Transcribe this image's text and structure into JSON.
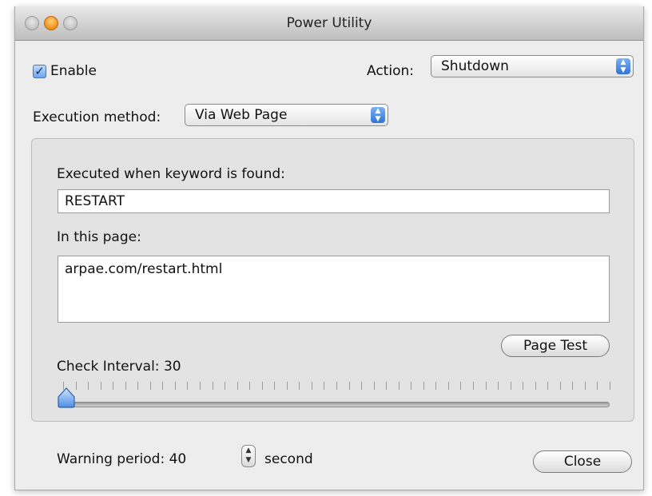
{
  "window": {
    "title": "Power Utility"
  },
  "enable": {
    "label": "Enable",
    "checked": true
  },
  "action": {
    "label": "Action:",
    "value": "Shutdown"
  },
  "execution": {
    "label": "Execution method:",
    "value": "Via Web Page"
  },
  "keyword": {
    "label": "Executed when keyword is found:",
    "value": "RESTART"
  },
  "page": {
    "label": "In this page:",
    "value": "arpae.com/restart.html"
  },
  "page_test_button": "Page Test",
  "interval": {
    "label": "Check Interval:",
    "value": "30"
  },
  "warning": {
    "label": "Warning period:",
    "value": "40",
    "unit": "second"
  },
  "close_button": "Close",
  "icons": {
    "checkbox": "checkmark-icon",
    "popup": "updown-arrows-icon",
    "stepper": "stepper-arrows-icon"
  },
  "colors": {
    "accent": "#3b82e6",
    "window": "#ededed",
    "panel": "#e3e3e3"
  }
}
